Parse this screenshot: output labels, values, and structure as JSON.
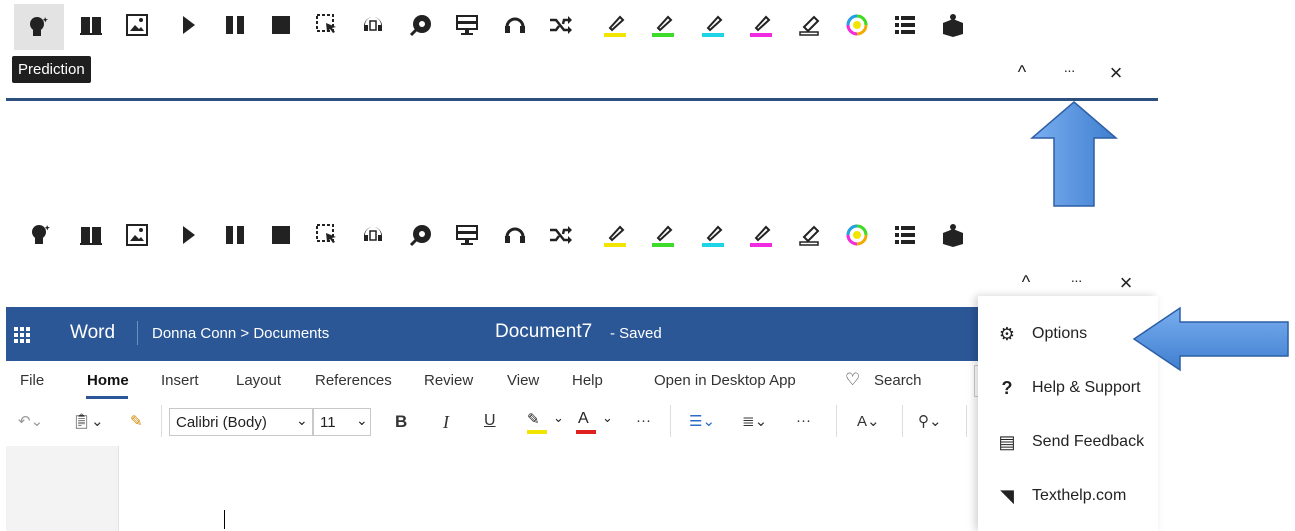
{
  "toolbar_icons": [
    "prediction-icon",
    "dictionary-icon",
    "picture-dictionary-icon",
    "play-icon",
    "pause-icon",
    "stop-icon",
    "screenshot-reader-icon",
    "audio-maker-icon",
    "speech-input-icon",
    "screen-mask-icon",
    "talk-and-type-icon",
    "rewordify-icon",
    "highlight-yellow-icon",
    "highlight-green-icon",
    "highlight-blue-icon",
    "highlight-pink-icon",
    "clear-highlights-icon",
    "collect-highlights-icon",
    "vocabulary-list-icon",
    "check-it-icon"
  ],
  "tooltip": "Prediction",
  "window_controls": {
    "collapse": "^",
    "more": "···",
    "close": "×"
  },
  "word": {
    "app_name": "Word",
    "breadcrumb": "Donna Conn > Documents",
    "doc_title": "Document7",
    "status": "-  Saved"
  },
  "menubar": [
    "File",
    "Home",
    "Insert",
    "Layout",
    "References",
    "Review",
    "View",
    "Help",
    "Open in Desktop App",
    "Search"
  ],
  "format": {
    "font": "Calibri (Body)",
    "size": "11",
    "bold": "B",
    "italic": "I",
    "underline": "U",
    "more": "···"
  },
  "dropdown": [
    {
      "label": "Options",
      "icon": "gear-icon"
    },
    {
      "label": "Help & Support",
      "icon": "question-icon"
    },
    {
      "label": "Send Feedback",
      "icon": "feedback-icon"
    },
    {
      "label": "Texthelp.com",
      "icon": "texthelp-icon"
    }
  ],
  "colors": {
    "word_blue": "#2b5797",
    "rule_blue": "#2c4f7d",
    "arrow_blue": "#4f8bd4"
  }
}
